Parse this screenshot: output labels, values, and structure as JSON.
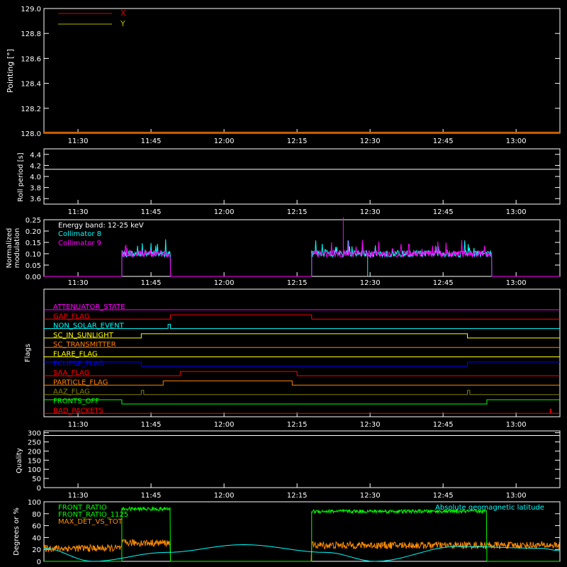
{
  "time_axis": {
    "ticks": [
      "11:30",
      "11:45",
      "12:00",
      "12:15",
      "12:30",
      "12:45",
      "13:00"
    ],
    "tick_minutes": [
      690,
      705,
      720,
      735,
      750,
      765,
      780
    ],
    "range_minutes": [
      683,
      789
    ]
  },
  "colors": {
    "background": "#000000",
    "axes": "#ffffff",
    "x": "#e00000",
    "y": "#b4b400",
    "cyan": "#00ffff",
    "magenta": "#ff00ff",
    "green": "#00ff00",
    "orange": "#ff8c00"
  },
  "chart_data": [
    {
      "type": "line",
      "ylabel": "Pointing [°]",
      "ylim": [
        128.0,
        129.0
      ],
      "yticks": [
        "128.0",
        "128.2",
        "128.4",
        "128.6",
        "128.8",
        "129.0"
      ],
      "yticks_values": [
        128.0,
        128.2,
        128.4,
        128.6,
        128.8,
        129.0
      ],
      "legend": "top-left",
      "series": [
        {
          "name": "X",
          "color": "#e00000",
          "x": [
            683,
            789
          ],
          "y": [
            128.0,
            128.0
          ]
        },
        {
          "name": "Y",
          "color": "#b4b400",
          "x": [
            683,
            789
          ],
          "y": [
            128.0,
            128.0
          ]
        }
      ]
    },
    {
      "type": "line",
      "ylabel": "Roll period [s]",
      "ylim": [
        3.5,
        4.5
      ],
      "yticks": [
        "3.6",
        "3.8",
        "4.0",
        "4.2",
        "4.4"
      ],
      "yticks_values": [
        3.6,
        3.8,
        4.0,
        4.2,
        4.4
      ],
      "series": [
        {
          "name": "",
          "color": "#ffffff",
          "x": [
            683,
            789
          ],
          "y": [
            4.13,
            4.13
          ]
        }
      ]
    },
    {
      "type": "line",
      "ylabel": "Normalized\nmodulation",
      "ylim": [
        0,
        0.25
      ],
      "yticks": [
        "0.00",
        "0.05",
        "0.10",
        "0.15",
        "0.20",
        "0.25"
      ],
      "yticks_values": [
        0,
        0.05,
        0.1,
        0.15,
        0.2,
        0.25
      ],
      "annotation": "Energy band: 12-25 keV",
      "legend": "top-left",
      "series": [
        {
          "name": "Collimator 8",
          "color": "#00ffff",
          "segments": [
            [
              699,
              709,
              0.1
            ],
            [
              738,
              775,
              0.1
            ]
          ],
          "spike": [
            [
              749.5,
              0.0
            ]
          ]
        },
        {
          "name": "Collimator 9",
          "color": "#ff00ff",
          "segments": [
            [
              699,
              709,
              0.1
            ],
            [
              738,
              775,
              0.1
            ]
          ],
          "spike": [
            [
              744.5,
              0.26
            ]
          ]
        }
      ]
    },
    {
      "type": "flags",
      "ylabel": "Flags",
      "rows": [
        {
          "label": "ATTENUATOR_STATE",
          "color": "#ff00ff",
          "steps": []
        },
        {
          "label": "GAP_FLAG",
          "color": "#ff0000",
          "steps": [
            [
              683,
              0
            ],
            [
              709,
              1
            ],
            [
              738,
              0
            ]
          ]
        },
        {
          "label": "NON_SOLAR_EVENT",
          "color": "#00ffff",
          "steps": [
            [
              683,
              0
            ],
            [
              708.5,
              1
            ],
            [
              709,
              0
            ]
          ]
        },
        {
          "label": "SC_IN_SUNLIGHT",
          "color": "#ffff00",
          "steps": [
            [
              683,
              0
            ],
            [
              703,
              1
            ],
            [
              770,
              0
            ]
          ]
        },
        {
          "label": "SC_TRANSMITTER",
          "color": "#ff8000",
          "steps": []
        },
        {
          "label": "FLARE_FLAG",
          "color": "#ffff00",
          "steps": []
        },
        {
          "label": "ECLIPSE_FLAG",
          "color": "#0000ff",
          "steps": [
            [
              683,
              1
            ],
            [
              703,
              0
            ],
            [
              770,
              1
            ]
          ]
        },
        {
          "label": "SAA_FLAG",
          "color": "#ff0000",
          "steps": [
            [
              683,
              0
            ],
            [
              711,
              1
            ],
            [
              735,
              0
            ]
          ]
        },
        {
          "label": "PARTICLE_FLAG",
          "color": "#ff8000",
          "steps": [
            [
              683,
              0
            ],
            [
              707.5,
              1
            ],
            [
              734,
              0
            ]
          ]
        },
        {
          "label": "AAZ_FLAG",
          "color": "#808000",
          "steps": [
            [
              683,
              0
            ],
            [
              703,
              1
            ],
            [
              703.5,
              0
            ],
            [
              770,
              1
            ],
            [
              770.5,
              0
            ]
          ]
        },
        {
          "label": "FRONTS_OFF",
          "color": "#00ff00",
          "steps": [
            [
              683,
              1
            ],
            [
              699,
              0
            ],
            [
              774,
              1
            ]
          ]
        },
        {
          "label": "BAD_PACKETS",
          "color": "#ff0000",
          "steps": [
            [
              683,
              0
            ],
            [
              787,
              1
            ],
            [
              787.2,
              0
            ]
          ]
        }
      ]
    },
    {
      "type": "line",
      "ylabel": "Quality",
      "ylim": [
        0,
        310
      ],
      "yticks": [
        "0",
        "50",
        "100",
        "150",
        "200",
        "250",
        "300"
      ],
      "yticks_values": [
        0,
        50,
        100,
        150,
        200,
        250,
        300
      ],
      "series": [
        {
          "name": "",
          "color": "#ffffff",
          "x": [
            683,
            789
          ],
          "y": [
            285,
            285
          ]
        }
      ]
    },
    {
      "type": "line",
      "ylabel": "Degrees or %",
      "ylim": [
        0,
        100
      ],
      "yticks": [
        "0",
        "20",
        "40",
        "60",
        "80",
        "100"
      ],
      "yticks_values": [
        0,
        20,
        40,
        60,
        80,
        100
      ],
      "legend": "top-left",
      "annotation": "Absolute geomagnetic latitude",
      "series": [
        {
          "name": "FRONT_RATIO",
          "color": "#00ff00",
          "segments": [
            [
              699,
              709,
              88
            ],
            [
              738,
              774,
              84
            ]
          ]
        },
        {
          "name": "FRONT_RATIO_1125",
          "color": "#00ff00",
          "segments": []
        },
        {
          "name": "MAX_DET_VS_TOT",
          "color": "#ff8c00",
          "segments": [
            [
              683,
              699,
              22
            ],
            [
              699,
              709,
              31
            ],
            [
              709,
              738,
              0
            ],
            [
              738,
              789,
              27
            ]
          ]
        },
        {
          "name": "Absolute geomagnetic latitude",
          "color": "#00ffff",
          "x": [
            683,
            693,
            708,
            724,
            741,
            751,
            768,
            785,
            789
          ],
          "y": [
            22,
            0,
            15,
            28,
            15,
            0,
            25,
            22,
            18
          ]
        }
      ]
    }
  ]
}
